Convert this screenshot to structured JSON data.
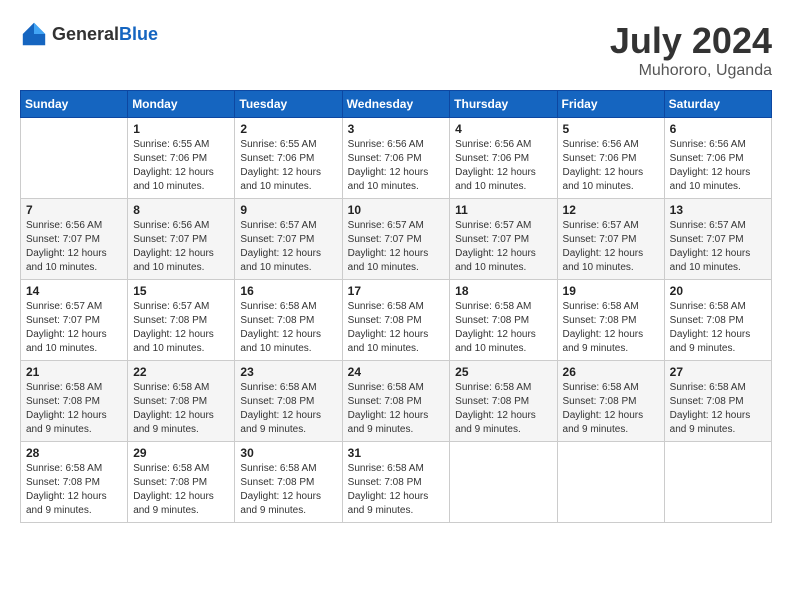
{
  "logo": {
    "text_general": "General",
    "text_blue": "Blue"
  },
  "title": {
    "month_year": "July 2024",
    "location": "Muhororo, Uganda"
  },
  "days_of_week": [
    "Sunday",
    "Monday",
    "Tuesday",
    "Wednesday",
    "Thursday",
    "Friday",
    "Saturday"
  ],
  "weeks": [
    [
      {
        "day": "",
        "sunrise": "",
        "sunset": "",
        "daylight": ""
      },
      {
        "day": "1",
        "sunrise": "Sunrise: 6:55 AM",
        "sunset": "Sunset: 7:06 PM",
        "daylight": "Daylight: 12 hours and 10 minutes."
      },
      {
        "day": "2",
        "sunrise": "Sunrise: 6:55 AM",
        "sunset": "Sunset: 7:06 PM",
        "daylight": "Daylight: 12 hours and 10 minutes."
      },
      {
        "day": "3",
        "sunrise": "Sunrise: 6:56 AM",
        "sunset": "Sunset: 7:06 PM",
        "daylight": "Daylight: 12 hours and 10 minutes."
      },
      {
        "day": "4",
        "sunrise": "Sunrise: 6:56 AM",
        "sunset": "Sunset: 7:06 PM",
        "daylight": "Daylight: 12 hours and 10 minutes."
      },
      {
        "day": "5",
        "sunrise": "Sunrise: 6:56 AM",
        "sunset": "Sunset: 7:06 PM",
        "daylight": "Daylight: 12 hours and 10 minutes."
      },
      {
        "day": "6",
        "sunrise": "Sunrise: 6:56 AM",
        "sunset": "Sunset: 7:06 PM",
        "daylight": "Daylight: 12 hours and 10 minutes."
      }
    ],
    [
      {
        "day": "7",
        "sunrise": "Sunrise: 6:56 AM",
        "sunset": "Sunset: 7:07 PM",
        "daylight": "Daylight: 12 hours and 10 minutes."
      },
      {
        "day": "8",
        "sunrise": "Sunrise: 6:56 AM",
        "sunset": "Sunset: 7:07 PM",
        "daylight": "Daylight: 12 hours and 10 minutes."
      },
      {
        "day": "9",
        "sunrise": "Sunrise: 6:57 AM",
        "sunset": "Sunset: 7:07 PM",
        "daylight": "Daylight: 12 hours and 10 minutes."
      },
      {
        "day": "10",
        "sunrise": "Sunrise: 6:57 AM",
        "sunset": "Sunset: 7:07 PM",
        "daylight": "Daylight: 12 hours and 10 minutes."
      },
      {
        "day": "11",
        "sunrise": "Sunrise: 6:57 AM",
        "sunset": "Sunset: 7:07 PM",
        "daylight": "Daylight: 12 hours and 10 minutes."
      },
      {
        "day": "12",
        "sunrise": "Sunrise: 6:57 AM",
        "sunset": "Sunset: 7:07 PM",
        "daylight": "Daylight: 12 hours and 10 minutes."
      },
      {
        "day": "13",
        "sunrise": "Sunrise: 6:57 AM",
        "sunset": "Sunset: 7:07 PM",
        "daylight": "Daylight: 12 hours and 10 minutes."
      }
    ],
    [
      {
        "day": "14",
        "sunrise": "Sunrise: 6:57 AM",
        "sunset": "Sunset: 7:07 PM",
        "daylight": "Daylight: 12 hours and 10 minutes."
      },
      {
        "day": "15",
        "sunrise": "Sunrise: 6:57 AM",
        "sunset": "Sunset: 7:08 PM",
        "daylight": "Daylight: 12 hours and 10 minutes."
      },
      {
        "day": "16",
        "sunrise": "Sunrise: 6:58 AM",
        "sunset": "Sunset: 7:08 PM",
        "daylight": "Daylight: 12 hours and 10 minutes."
      },
      {
        "day": "17",
        "sunrise": "Sunrise: 6:58 AM",
        "sunset": "Sunset: 7:08 PM",
        "daylight": "Daylight: 12 hours and 10 minutes."
      },
      {
        "day": "18",
        "sunrise": "Sunrise: 6:58 AM",
        "sunset": "Sunset: 7:08 PM",
        "daylight": "Daylight: 12 hours and 10 minutes."
      },
      {
        "day": "19",
        "sunrise": "Sunrise: 6:58 AM",
        "sunset": "Sunset: 7:08 PM",
        "daylight": "Daylight: 12 hours and 9 minutes."
      },
      {
        "day": "20",
        "sunrise": "Sunrise: 6:58 AM",
        "sunset": "Sunset: 7:08 PM",
        "daylight": "Daylight: 12 hours and 9 minutes."
      }
    ],
    [
      {
        "day": "21",
        "sunrise": "Sunrise: 6:58 AM",
        "sunset": "Sunset: 7:08 PM",
        "daylight": "Daylight: 12 hours and 9 minutes."
      },
      {
        "day": "22",
        "sunrise": "Sunrise: 6:58 AM",
        "sunset": "Sunset: 7:08 PM",
        "daylight": "Daylight: 12 hours and 9 minutes."
      },
      {
        "day": "23",
        "sunrise": "Sunrise: 6:58 AM",
        "sunset": "Sunset: 7:08 PM",
        "daylight": "Daylight: 12 hours and 9 minutes."
      },
      {
        "day": "24",
        "sunrise": "Sunrise: 6:58 AM",
        "sunset": "Sunset: 7:08 PM",
        "daylight": "Daylight: 12 hours and 9 minutes."
      },
      {
        "day": "25",
        "sunrise": "Sunrise: 6:58 AM",
        "sunset": "Sunset: 7:08 PM",
        "daylight": "Daylight: 12 hours and 9 minutes."
      },
      {
        "day": "26",
        "sunrise": "Sunrise: 6:58 AM",
        "sunset": "Sunset: 7:08 PM",
        "daylight": "Daylight: 12 hours and 9 minutes."
      },
      {
        "day": "27",
        "sunrise": "Sunrise: 6:58 AM",
        "sunset": "Sunset: 7:08 PM",
        "daylight": "Daylight: 12 hours and 9 minutes."
      }
    ],
    [
      {
        "day": "28",
        "sunrise": "Sunrise: 6:58 AM",
        "sunset": "Sunset: 7:08 PM",
        "daylight": "Daylight: 12 hours and 9 minutes."
      },
      {
        "day": "29",
        "sunrise": "Sunrise: 6:58 AM",
        "sunset": "Sunset: 7:08 PM",
        "daylight": "Daylight: 12 hours and 9 minutes."
      },
      {
        "day": "30",
        "sunrise": "Sunrise: 6:58 AM",
        "sunset": "Sunset: 7:08 PM",
        "daylight": "Daylight: 12 hours and 9 minutes."
      },
      {
        "day": "31",
        "sunrise": "Sunrise: 6:58 AM",
        "sunset": "Sunset: 7:08 PM",
        "daylight": "Daylight: 12 hours and 9 minutes."
      },
      {
        "day": "",
        "sunrise": "",
        "sunset": "",
        "daylight": ""
      },
      {
        "day": "",
        "sunrise": "",
        "sunset": "",
        "daylight": ""
      },
      {
        "day": "",
        "sunrise": "",
        "sunset": "",
        "daylight": ""
      }
    ]
  ]
}
